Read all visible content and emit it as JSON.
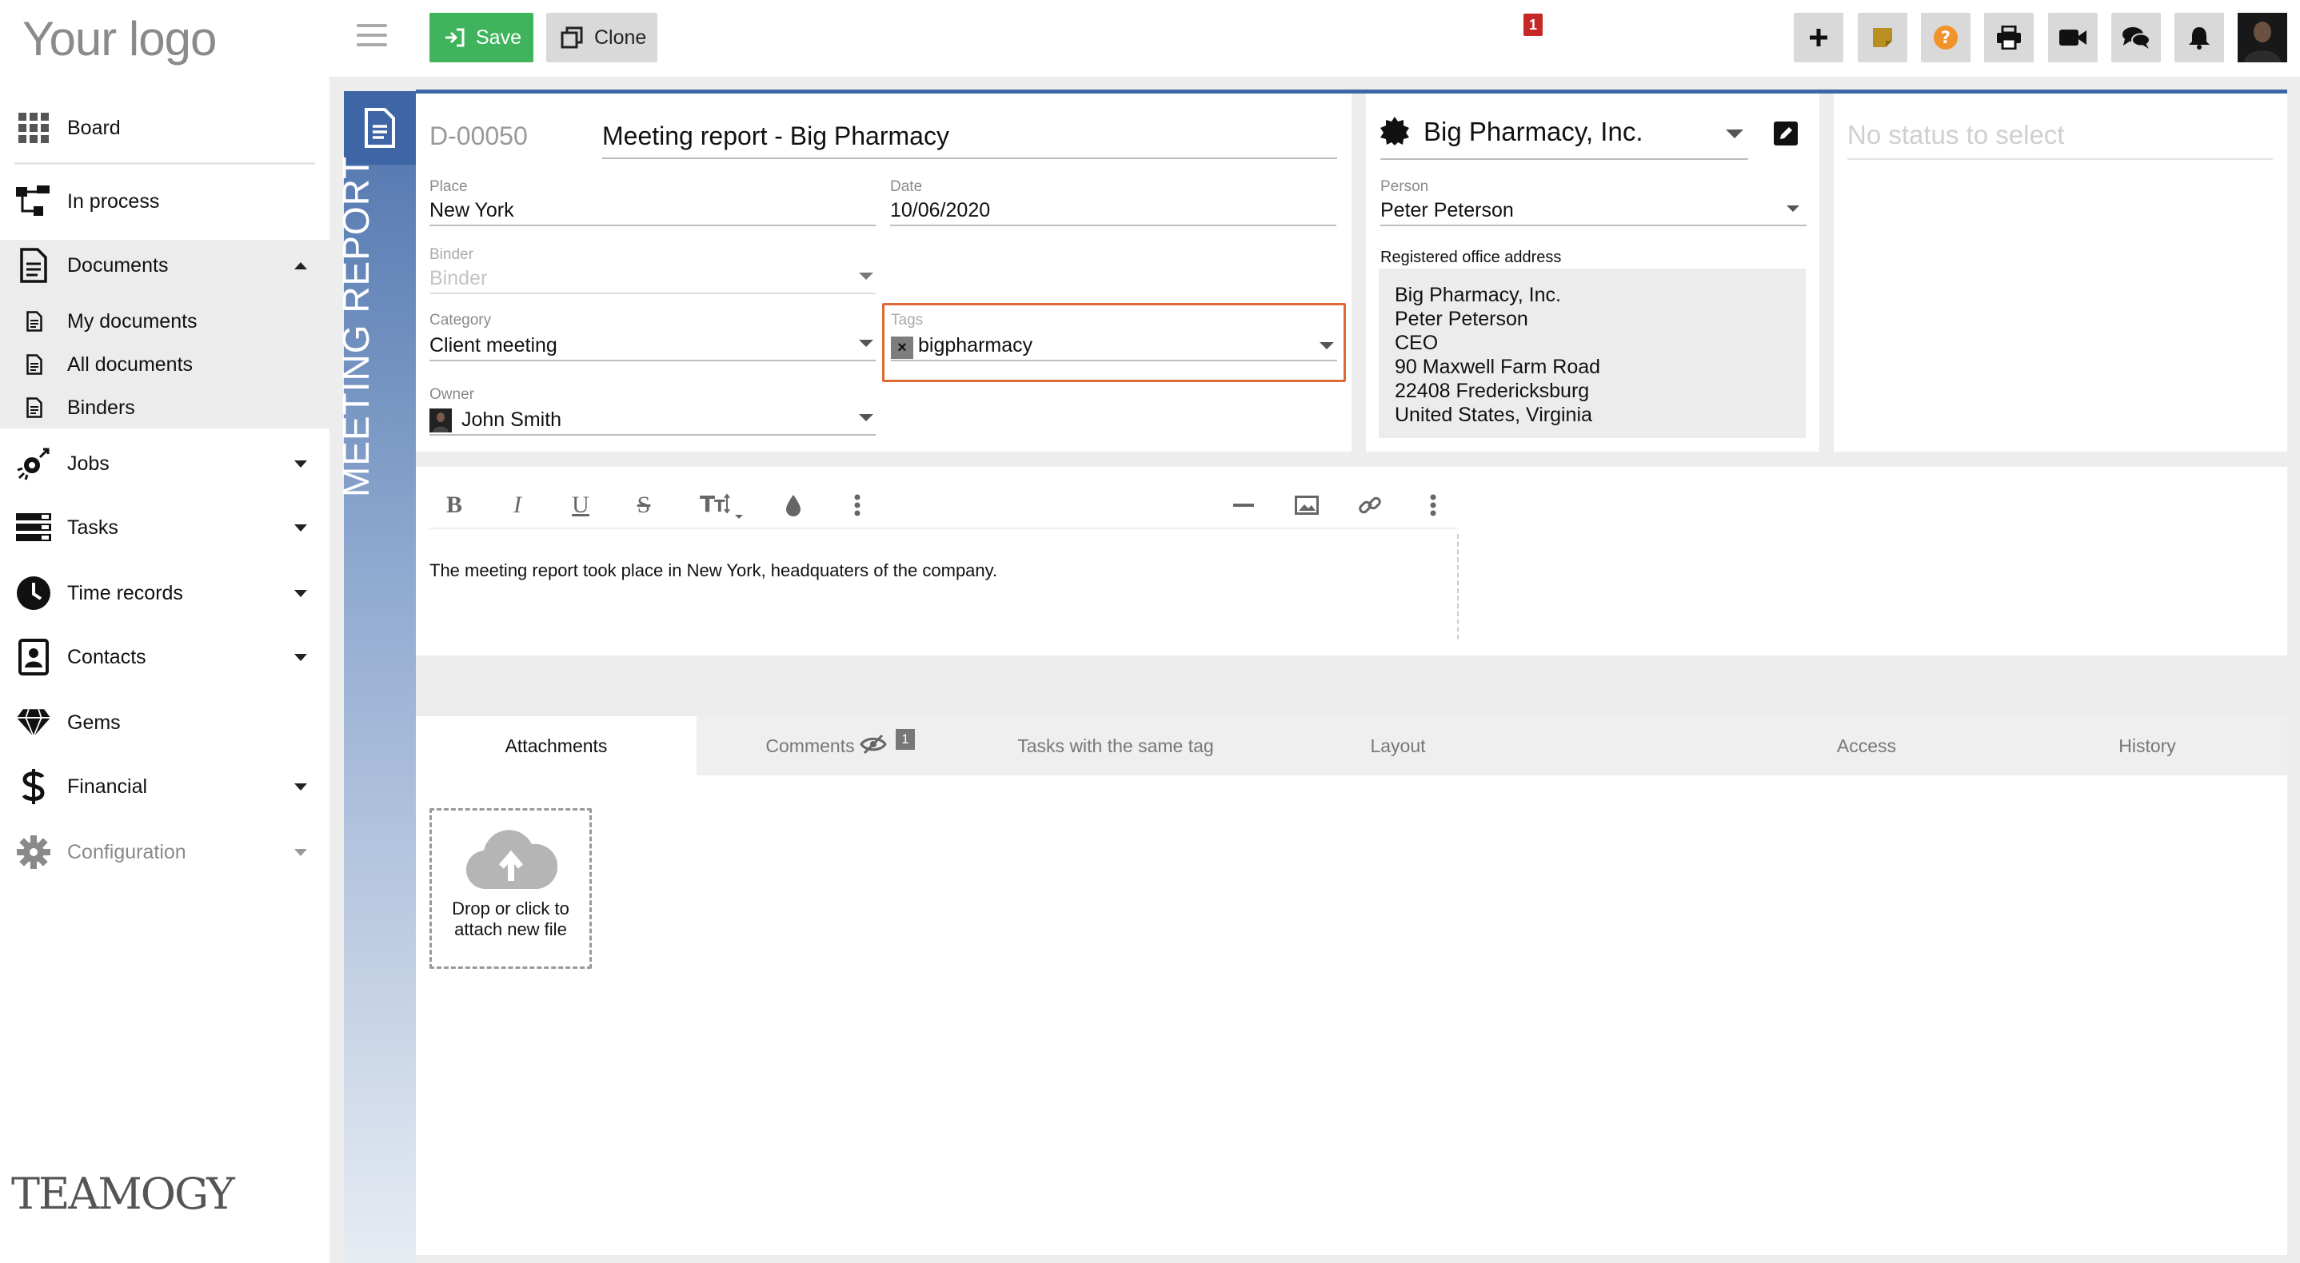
{
  "logo": "Your logo",
  "brand": "TEAMOGY",
  "sidebar": {
    "items": [
      {
        "label": "Board",
        "icon": "grid-icon"
      },
      {
        "label": "In process",
        "icon": "workflow-icon"
      },
      {
        "label": "Documents",
        "icon": "document-icon",
        "expanded": true
      },
      {
        "label": "My documents",
        "icon": "doc-small-icon"
      },
      {
        "label": "All documents",
        "icon": "doc-small-icon"
      },
      {
        "label": "Binders",
        "icon": "doc-small-icon"
      },
      {
        "label": "Jobs",
        "icon": "jobs-icon"
      },
      {
        "label": "Tasks",
        "icon": "tasks-icon"
      },
      {
        "label": "Time records",
        "icon": "clock-icon"
      },
      {
        "label": "Contacts",
        "icon": "contacts-icon"
      },
      {
        "label": "Gems",
        "icon": "gem-icon"
      },
      {
        "label": "Financial",
        "icon": "dollar-icon"
      },
      {
        "label": "Configuration",
        "icon": "gear-icon"
      }
    ]
  },
  "toolbar": {
    "save_label": "Save",
    "clone_label": "Clone",
    "notifications_count": "1",
    "right_icons": [
      "plus-icon",
      "sticky-note-icon",
      "help-icon",
      "print-icon",
      "video-icon",
      "chat-icon",
      "bell-icon",
      "avatar"
    ]
  },
  "document": {
    "vertical_title": "MEETING REPORT",
    "number": "D-00050",
    "title": "Meeting report - Big Pharmacy",
    "place": {
      "label": "Place",
      "value": "New York"
    },
    "date": {
      "label": "Date",
      "value": "10/06/2020"
    },
    "binder": {
      "label": "Binder",
      "placeholder": "Binder"
    },
    "category": {
      "label": "Category",
      "value": "Client meeting"
    },
    "tags": {
      "label": "Tags",
      "value": "bigpharmacy"
    },
    "owner": {
      "label": "Owner",
      "value": "John Smith"
    }
  },
  "contact": {
    "company": "Big Pharmacy, Inc.",
    "person_label": "Person",
    "person": "Peter Peterson",
    "address_label": "Registered office address",
    "address_lines": [
      "Big Pharmacy, Inc.",
      "Peter Peterson",
      "CEO",
      "90 Maxwell Farm Road",
      "22408 Fredericksburg",
      "United States, Virginia"
    ]
  },
  "status": {
    "placeholder": "No status to select"
  },
  "editor": {
    "content": "The meeting report took place in New York, headquaters of the company."
  },
  "tabs": [
    {
      "label": "Attachments",
      "active": true
    },
    {
      "label": "Comments",
      "badge": "1"
    },
    {
      "label": "Tasks with the same tag"
    },
    {
      "label": "Layout"
    },
    {
      "label": "Access"
    },
    {
      "label": "History"
    }
  ],
  "dropzone": {
    "line1": "Drop or click to",
    "line2": "attach new file"
  },
  "colors": {
    "save": "#3fb45c",
    "accent": "#3e66a6",
    "tags_highlight": "#e06a35",
    "badge": "#c62828"
  }
}
